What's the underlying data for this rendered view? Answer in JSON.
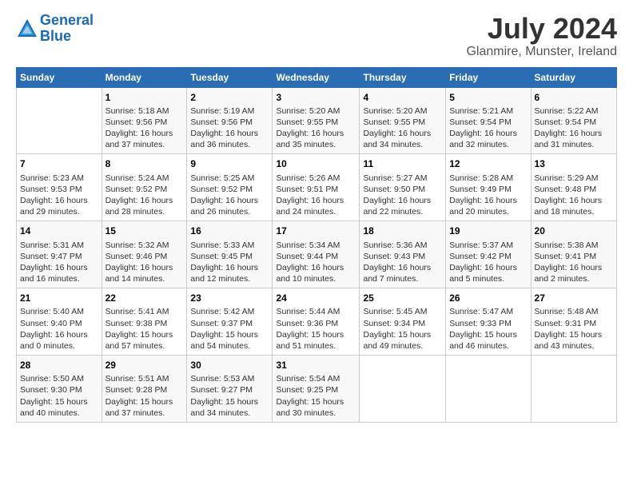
{
  "header": {
    "logo_line1": "General",
    "logo_line2": "Blue",
    "title": "July 2024",
    "subtitle": "Glanmire, Munster, Ireland"
  },
  "columns": [
    "Sunday",
    "Monday",
    "Tuesday",
    "Wednesday",
    "Thursday",
    "Friday",
    "Saturday"
  ],
  "weeks": [
    [
      {
        "day": "",
        "info": ""
      },
      {
        "day": "1",
        "info": "Sunrise: 5:18 AM\nSunset: 9:56 PM\nDaylight: 16 hours and 37 minutes."
      },
      {
        "day": "2",
        "info": "Sunrise: 5:19 AM\nSunset: 9:56 PM\nDaylight: 16 hours and 36 minutes."
      },
      {
        "day": "3",
        "info": "Sunrise: 5:20 AM\nSunset: 9:55 PM\nDaylight: 16 hours and 35 minutes."
      },
      {
        "day": "4",
        "info": "Sunrise: 5:20 AM\nSunset: 9:55 PM\nDaylight: 16 hours and 34 minutes."
      },
      {
        "day": "5",
        "info": "Sunrise: 5:21 AM\nSunset: 9:54 PM\nDaylight: 16 hours and 32 minutes."
      },
      {
        "day": "6",
        "info": "Sunrise: 5:22 AM\nSunset: 9:54 PM\nDaylight: 16 hours and 31 minutes."
      }
    ],
    [
      {
        "day": "7",
        "info": "Sunrise: 5:23 AM\nSunset: 9:53 PM\nDaylight: 16 hours and 29 minutes."
      },
      {
        "day": "8",
        "info": "Sunrise: 5:24 AM\nSunset: 9:52 PM\nDaylight: 16 hours and 28 minutes."
      },
      {
        "day": "9",
        "info": "Sunrise: 5:25 AM\nSunset: 9:52 PM\nDaylight: 16 hours and 26 minutes."
      },
      {
        "day": "10",
        "info": "Sunrise: 5:26 AM\nSunset: 9:51 PM\nDaylight: 16 hours and 24 minutes."
      },
      {
        "day": "11",
        "info": "Sunrise: 5:27 AM\nSunset: 9:50 PM\nDaylight: 16 hours and 22 minutes."
      },
      {
        "day": "12",
        "info": "Sunrise: 5:28 AM\nSunset: 9:49 PM\nDaylight: 16 hours and 20 minutes."
      },
      {
        "day": "13",
        "info": "Sunrise: 5:29 AM\nSunset: 9:48 PM\nDaylight: 16 hours and 18 minutes."
      }
    ],
    [
      {
        "day": "14",
        "info": "Sunrise: 5:31 AM\nSunset: 9:47 PM\nDaylight: 16 hours and 16 minutes."
      },
      {
        "day": "15",
        "info": "Sunrise: 5:32 AM\nSunset: 9:46 PM\nDaylight: 16 hours and 14 minutes."
      },
      {
        "day": "16",
        "info": "Sunrise: 5:33 AM\nSunset: 9:45 PM\nDaylight: 16 hours and 12 minutes."
      },
      {
        "day": "17",
        "info": "Sunrise: 5:34 AM\nSunset: 9:44 PM\nDaylight: 16 hours and 10 minutes."
      },
      {
        "day": "18",
        "info": "Sunrise: 5:36 AM\nSunset: 9:43 PM\nDaylight: 16 hours and 7 minutes."
      },
      {
        "day": "19",
        "info": "Sunrise: 5:37 AM\nSunset: 9:42 PM\nDaylight: 16 hours and 5 minutes."
      },
      {
        "day": "20",
        "info": "Sunrise: 5:38 AM\nSunset: 9:41 PM\nDaylight: 16 hours and 2 minutes."
      }
    ],
    [
      {
        "day": "21",
        "info": "Sunrise: 5:40 AM\nSunset: 9:40 PM\nDaylight: 16 hours and 0 minutes."
      },
      {
        "day": "22",
        "info": "Sunrise: 5:41 AM\nSunset: 9:38 PM\nDaylight: 15 hours and 57 minutes."
      },
      {
        "day": "23",
        "info": "Sunrise: 5:42 AM\nSunset: 9:37 PM\nDaylight: 15 hours and 54 minutes."
      },
      {
        "day": "24",
        "info": "Sunrise: 5:44 AM\nSunset: 9:36 PM\nDaylight: 15 hours and 51 minutes."
      },
      {
        "day": "25",
        "info": "Sunrise: 5:45 AM\nSunset: 9:34 PM\nDaylight: 15 hours and 49 minutes."
      },
      {
        "day": "26",
        "info": "Sunrise: 5:47 AM\nSunset: 9:33 PM\nDaylight: 15 hours and 46 minutes."
      },
      {
        "day": "27",
        "info": "Sunrise: 5:48 AM\nSunset: 9:31 PM\nDaylight: 15 hours and 43 minutes."
      }
    ],
    [
      {
        "day": "28",
        "info": "Sunrise: 5:50 AM\nSunset: 9:30 PM\nDaylight: 15 hours and 40 minutes."
      },
      {
        "day": "29",
        "info": "Sunrise: 5:51 AM\nSunset: 9:28 PM\nDaylight: 15 hours and 37 minutes."
      },
      {
        "day": "30",
        "info": "Sunrise: 5:53 AM\nSunset: 9:27 PM\nDaylight: 15 hours and 34 minutes."
      },
      {
        "day": "31",
        "info": "Sunrise: 5:54 AM\nSunset: 9:25 PM\nDaylight: 15 hours and 30 minutes."
      },
      {
        "day": "",
        "info": ""
      },
      {
        "day": "",
        "info": ""
      },
      {
        "day": "",
        "info": ""
      }
    ]
  ]
}
